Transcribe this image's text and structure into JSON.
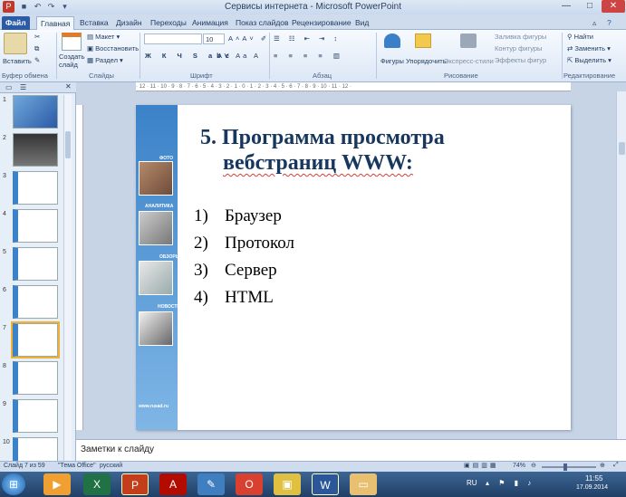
{
  "window": {
    "title": "Сервисы интернета - Microsoft PowerPoint"
  },
  "tabs": {
    "file": "Файл",
    "home": "Главная",
    "insert": "Вставка",
    "design": "Дизайн",
    "transitions": "Переходы",
    "animations": "Анимация",
    "slideshow": "Показ слайдов",
    "review": "Рецензирование",
    "view": "Вид"
  },
  "ribbon": {
    "paste": "Вставить",
    "create_slide": "Создать\nслайд",
    "layout": "Макет",
    "reset": "Восстановить",
    "section": "Раздел",
    "font_size": "10",
    "shapes": "Фигуры",
    "arrange": "Упорядочить",
    "express_styles": "Экспресс-стили",
    "shape_fill": "Заливка фигуры",
    "shape_outline": "Контур фигуры",
    "shape_effects": "Эффекты фигур",
    "find": "Найти",
    "replace": "Заменить",
    "select": "Выделить",
    "groups": {
      "clipboard": "Буфер обмена",
      "slides": "Слайды",
      "font": "Шрифт",
      "paragraph": "Абзац",
      "drawing": "Рисование",
      "editing": "Редактирование"
    }
  },
  "ruler": "· 12 · 11 · 10 · 9 · 8 · 7 · 6 · 5 · 4 · 3 · 2 · 1 · 0 · 1 · 2 · 3 · 4 · 5 · 6 · 7 · 8 · 9 · 10 · 11 · 12 ·",
  "thumbs": [
    {
      "num": "1"
    },
    {
      "num": "2"
    },
    {
      "num": "3"
    },
    {
      "num": "4"
    },
    {
      "num": "5"
    },
    {
      "num": "6"
    },
    {
      "num": "7"
    },
    {
      "num": "8"
    },
    {
      "num": "9"
    },
    {
      "num": "10"
    }
  ],
  "slide": {
    "title_line1": "5. Программа просмотра",
    "title_line2": "вебстраниц  WWW:",
    "items": [
      {
        "n": "1)",
        "t": "Браузер"
      },
      {
        "n": "2)",
        "t": "Протокол"
      },
      {
        "n": "3)",
        "t": "Сервер"
      },
      {
        "n": "4)",
        "t": "HTML"
      }
    ],
    "sidebar_labels": [
      "ФОТО",
      "АНАЛИТИКА",
      "ОБЗОРЫ",
      "НОВОСТИ"
    ],
    "sidebar_url": "www.rusad.ru"
  },
  "notes_placeholder": "Заметки к слайду",
  "status": {
    "slide": "Слайд 7 из 59",
    "theme": "\"Тема Office\"",
    "lang": "русский",
    "zoom": "74%"
  },
  "taskbar": {
    "lang": "RU",
    "time": "11:55",
    "date": "17.09.2014"
  },
  "colors": {
    "accent": "#2b5aa6",
    "title": "#17375e"
  }
}
